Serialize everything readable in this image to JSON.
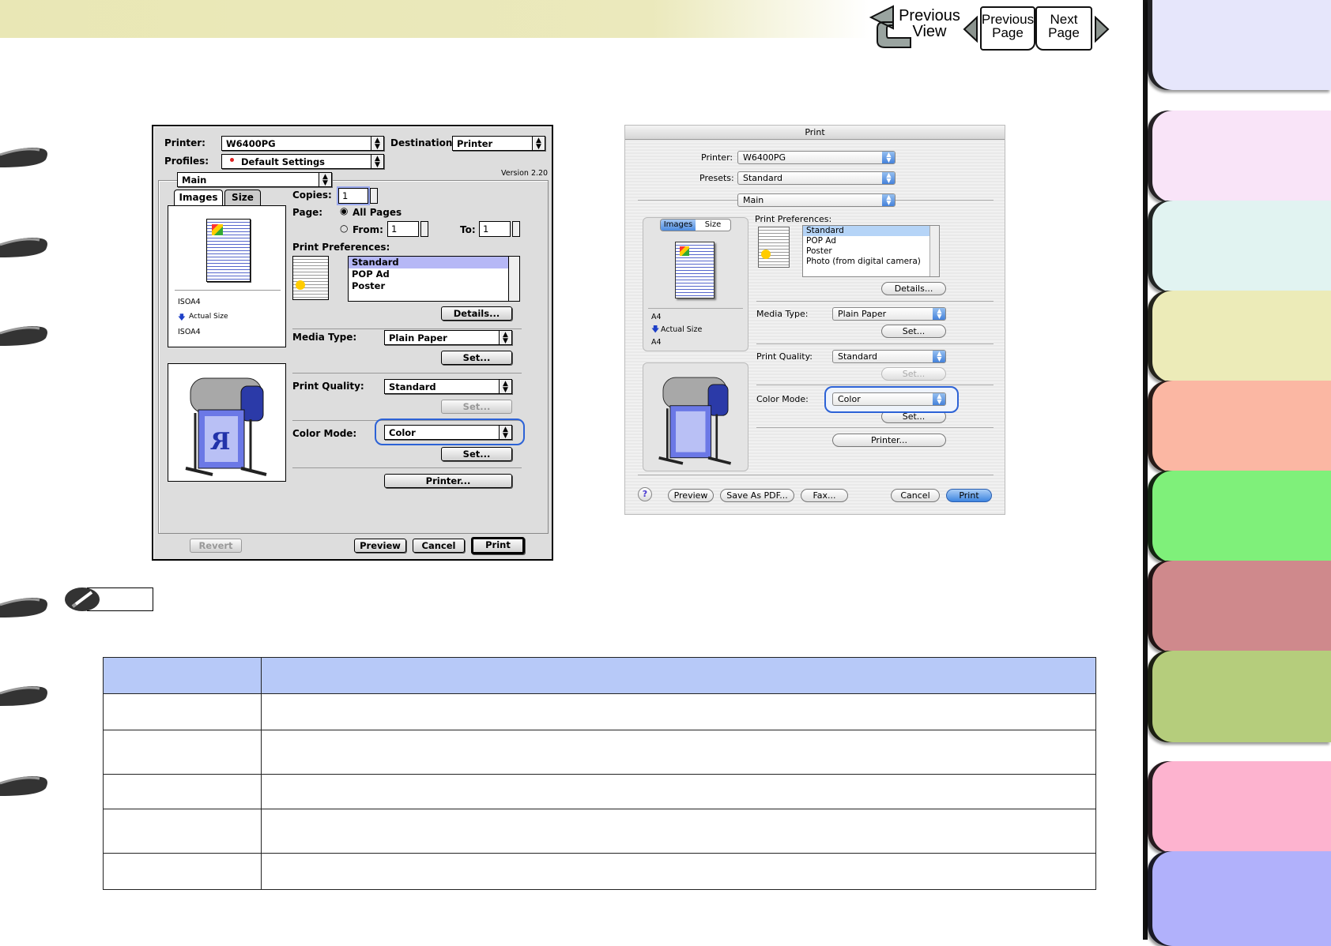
{
  "nav": {
    "previous_view_line1": "Previous",
    "previous_view_line2": "View",
    "previous_page_line1": "Previous",
    "previous_page_line2": "Page",
    "next_page_line1": "Next",
    "next_page_line2": "Page"
  },
  "os9_dialog": {
    "printer_label": "Printer:",
    "printer_value": "W6400PG",
    "destination_label": "Destination:",
    "destination_value": "Printer",
    "profiles_label": "Profiles:",
    "profiles_value": "Default Settings",
    "panel_value": "Main",
    "version": "Version 2.20",
    "tab_images": "Images",
    "tab_size": "Size",
    "paper_in": "ISOA4",
    "scale": "Actual Size",
    "paper_out": "ISOA4",
    "copies_label": "Copies:",
    "copies_value": "1",
    "page_label": "Page:",
    "all_pages": "All Pages",
    "from_label": "From:",
    "from_value": "1",
    "to_label": "To:",
    "to_value": "1",
    "print_prefs_label": "Print Preferences:",
    "prefs": [
      "Standard",
      "POP Ad",
      "Poster"
    ],
    "details_button": "Details...",
    "media_type_label": "Media Type:",
    "media_type_value": "Plain Paper",
    "set_button": "Set...",
    "print_quality_label": "Print Quality:",
    "print_quality_value": "Standard",
    "color_mode_label": "Color Mode:",
    "color_mode_value": "Color",
    "printer_button": "Printer...",
    "revert_button": "Revert",
    "preview_button": "Preview",
    "cancel_button": "Cancel",
    "print_button": "Print"
  },
  "aqua_dialog": {
    "title": "Print",
    "printer_label": "Printer:",
    "printer_value": "W6400PG",
    "presets_label": "Presets:",
    "presets_value": "Standard",
    "panel_value": "Main",
    "tab_images": "Images",
    "tab_size": "Size",
    "print_prefs_label": "Print Preferences:",
    "prefs": [
      "Standard",
      "POP Ad",
      "Poster",
      "Photo (from digital camera)"
    ],
    "paper_in": "A4",
    "scale": "Actual Size",
    "paper_out": "A4",
    "details_button": "Details...",
    "media_type_label": "Media Type:",
    "media_type_value": "Plain Paper",
    "set_button": "Set...",
    "print_quality_label": "Print Quality:",
    "print_quality_value": "Standard",
    "color_mode_label": "Color Mode:",
    "color_mode_value": "Color",
    "printer_button": "Printer...",
    "help_glyph": "?",
    "preview_button": "Preview",
    "save_pdf_button": "Save As PDF...",
    "fax_button": "Fax...",
    "cancel_button": "Cancel",
    "print_button": "Print"
  },
  "note_label": "",
  "table_rows": [
    [
      "",
      ""
    ],
    [
      "",
      ""
    ],
    [
      "",
      ""
    ],
    [
      "",
      ""
    ],
    [
      "",
      ""
    ],
    [
      "",
      ""
    ]
  ],
  "colors": {
    "tabs": [
      "#e6e6fb",
      "#f9e4f8",
      "#e1f3f1",
      "#ecebb8",
      "#fbb7a3",
      "#7ff07a",
      "#cf898c",
      "#b5cd7c",
      "#fdb3cf",
      "#b1b1fb"
    ],
    "table_header": "#b7c9f8",
    "highlight_ring": "#2c62d6"
  }
}
